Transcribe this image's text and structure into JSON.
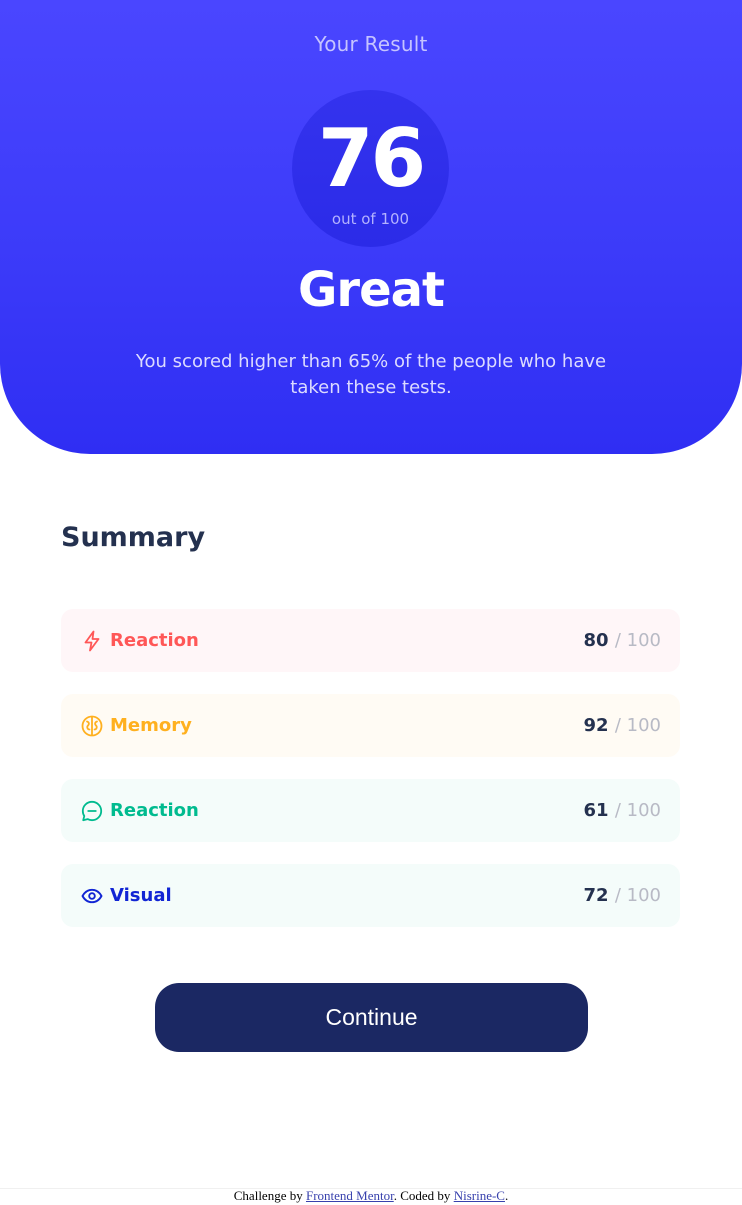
{
  "result": {
    "title": "Your Result",
    "score": "76",
    "score_max": "out of 100",
    "grade": "Great",
    "description": "You scored higher than 65% of the people who have taken these tests."
  },
  "summary": {
    "title": "Summary",
    "items": [
      {
        "label": "Reaction",
        "score": "80",
        "max": "/ 100",
        "icon": "lightning-icon",
        "color": "#ff5757",
        "bg": "#fff6f8"
      },
      {
        "label": "Memory",
        "score": "92",
        "max": "/ 100",
        "icon": "brain-icon",
        "color": "#ffb01f",
        "bg": "#fffbf4"
      },
      {
        "label": "Reaction",
        "score": "61",
        "max": "/ 100",
        "icon": "chat-bubble-icon",
        "color": "#00bb8f",
        "bg": "#f4fcfa"
      },
      {
        "label": "Visual",
        "score": "72",
        "max": "/ 100",
        "icon": "eye-icon",
        "color": "#1125d4",
        "bg": "#f4fcfa"
      }
    ]
  },
  "continue_label": "Continue",
  "footer": {
    "prefix": "Challenge by",
    "link1": "Frontend Mentor",
    "middle": ". Coded by",
    "link2": "Nisrine-C",
    "suffix": "."
  }
}
